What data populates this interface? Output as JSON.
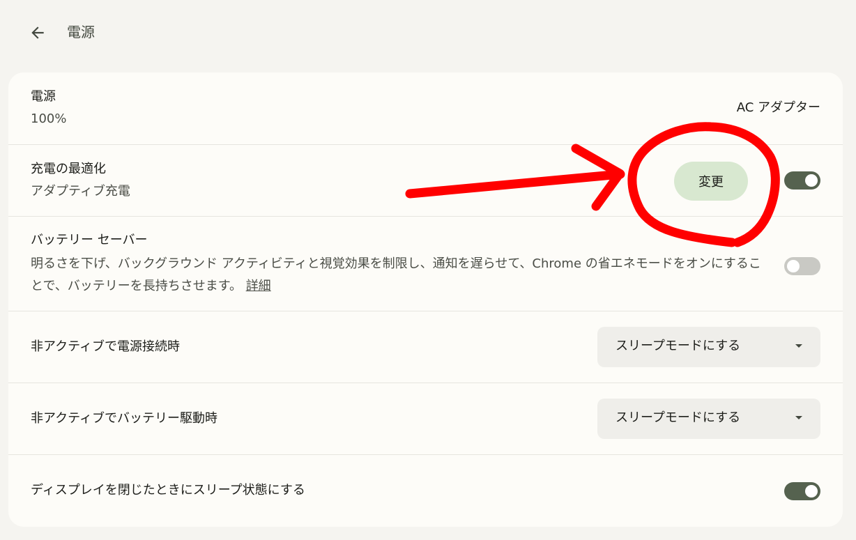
{
  "header": {
    "title": "電源",
    "back_icon": "arrow-back-icon"
  },
  "power_source": {
    "title": "電源",
    "level": "100%",
    "source": "AC アダプター"
  },
  "charging_optimization": {
    "title": "充電の最適化",
    "subtitle": "アダプティブ充電",
    "change_label": "変更",
    "enabled": true
  },
  "battery_saver": {
    "title": "バッテリー セーバー",
    "description": "明るさを下げ、バックグラウンド アクティビティと視覚効果を制限し、通知を遅らせて、Chrome の省エネモードをオンにすることで、バッテリーを長持ちさせます。",
    "learn_more": "詳細",
    "enabled": false
  },
  "idle_plugged": {
    "title": "非アクティブで電源接続時",
    "selected": "スリープモードにする"
  },
  "idle_battery": {
    "title": "非アクティブでバッテリー駆動時",
    "selected": "スリープモードにする"
  },
  "lid_close": {
    "title": "ディスプレイを閉じたときにスリープ状態にする",
    "enabled": true
  },
  "colors": {
    "background": "#f5f4f0",
    "card": "#fdfcf8",
    "toggle_on": "#55624f",
    "toggle_off": "#c9c9c4",
    "tonal_button": "#d8e8d0",
    "annotation": "#ff0000"
  }
}
